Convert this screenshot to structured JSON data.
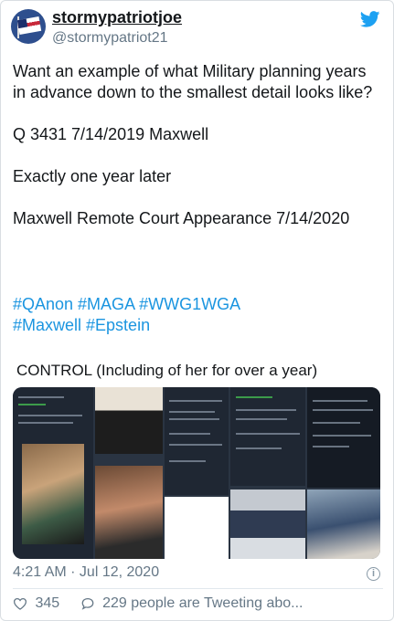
{
  "tweet": {
    "display_name": "stormypatriotjoe",
    "handle": "@stormypatriot21",
    "text_lines": [
      "Want an example of what Military planning years in advance down to the smallest detail looks like?",
      "Q 3431 7/14/2019 Maxwell",
      "Exactly one year later",
      "Maxwell Remote Court Appearance 7/14/2020"
    ],
    "hashtags_line1": "#QAnon #MAGA #WWG1WGA",
    "hashtags_line2": "#Maxwell #Epstein",
    "caption": "CONTROL (Including of her for over a year)",
    "timestamp": "4:21 AM · Jul 12, 2020",
    "info_glyph": "i",
    "likes": "345",
    "retweeting_text": "229 people are Tweeting abo..."
  },
  "icons": {
    "avatar": "flag-avatar-icon",
    "platform": "twitter-bird-icon",
    "info": "info-icon",
    "like": "heart-icon",
    "reply": "speech-bubble-icon"
  },
  "colors": {
    "link": "#1b95e0",
    "secondary_text": "#657786",
    "twitter_blue": "#1da1f2"
  }
}
